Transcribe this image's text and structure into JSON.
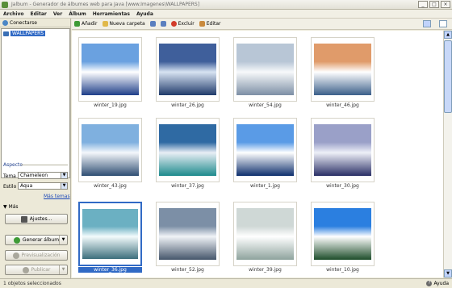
{
  "window": {
    "title": "Jalbum - Generador de álbumes web para Java [www.Imagenes\\WALLPAPERS]"
  },
  "menu": [
    "Archivo",
    "Editar",
    "Ver",
    "Álbum",
    "Herramientas",
    "Ayuda"
  ],
  "left": {
    "connect": "Conectarse",
    "tree_item": "WALLPAPERS",
    "aspect_title": "Aspecto",
    "theme_label": "Tema",
    "theme_value": "Chameleon",
    "style_label": "Estilo",
    "style_value": "Aqua",
    "more_themes": "Más temas",
    "more": "▼ Más",
    "settings_btn": "Ajustes...",
    "generate_btn": "Generar álbum",
    "preview_btn": "Previsualización",
    "publish_btn": "Publicar"
  },
  "toolbar": {
    "add": "Añadir",
    "new_folder": "Nueva carpeta",
    "exclude": "Excluir",
    "edit": "Editar"
  },
  "thumbs": [
    {
      "caption": "winter_19.jpg",
      "colors": [
        "#6aa1e0",
        "#ffffff",
        "#1f3f8a"
      ]
    },
    {
      "caption": "winter_26.jpg",
      "colors": [
        "#3f5f9b",
        "#d7e3f2",
        "#203b6b"
      ]
    },
    {
      "caption": "winter_54.jpg",
      "colors": [
        "#b8c6d6",
        "#f7f9fb",
        "#7d8fa5"
      ]
    },
    {
      "caption": "winter_46.jpg",
      "colors": [
        "#e09b6a",
        "#ffffff",
        "#3b5f8a"
      ]
    },
    {
      "caption": "winter_43.jpg",
      "colors": [
        "#7fb0df",
        "#f4f7fb",
        "#2f4e73"
      ]
    },
    {
      "caption": "winter_37.jpg",
      "colors": [
        "#2f6aa3",
        "#e8eef5",
        "#1d8a8c"
      ]
    },
    {
      "caption": "winter_1.jpg",
      "colors": [
        "#5a9be6",
        "#ffffff",
        "#0e2f6d"
      ]
    },
    {
      "caption": "winter_30.jpg",
      "colors": [
        "#9aa0c8",
        "#eef0f8",
        "#2a2f66"
      ]
    },
    {
      "caption": "winter_36.jpg",
      "colors": [
        "#6bb0c2",
        "#f3fbfc",
        "#3d6f7c"
      ]
    },
    {
      "caption": "winter_52.jpg",
      "colors": [
        "#7c8fa6",
        "#f0f3f7",
        "#45566b"
      ]
    },
    {
      "caption": "winter_39.jpg",
      "colors": [
        "#cfd8d6",
        "#ffffff",
        "#8ea39d"
      ]
    },
    {
      "caption": "winter_10.jpg",
      "colors": [
        "#2b7fe0",
        "#ffffff",
        "#1d4d2a"
      ]
    }
  ],
  "status": {
    "text": "1 objetos seleccionados",
    "help": "Ayuda"
  }
}
